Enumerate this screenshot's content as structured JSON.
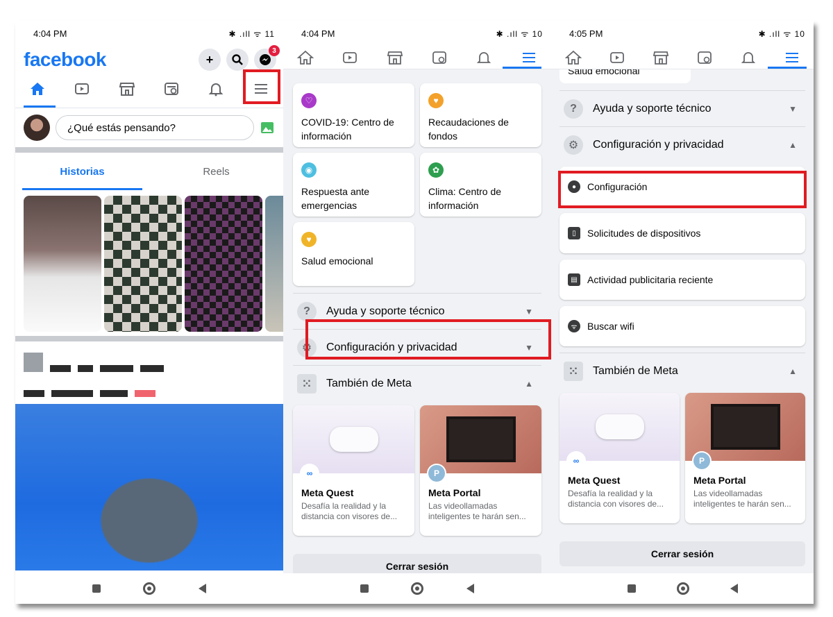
{
  "screen1": {
    "status": {
      "time": "4:04 PM",
      "icons": "✱ .ıll ᯤ 11"
    },
    "logo": "facebook",
    "messenger_badge": "3",
    "composer_placeholder": "¿Qué estás pensando?",
    "story_tabs": [
      "Historias",
      "Reels"
    ]
  },
  "screen2": {
    "status": {
      "time": "4:04 PM",
      "icons": "✱ .ıll ᯤ 10"
    },
    "shortcuts": [
      {
        "label": "COVID-19: Centro de información",
        "icon_color": "#a93ac9"
      },
      {
        "label": "Recaudaciones de fondos",
        "icon_color": "#f3a12b"
      },
      {
        "label": "Respuesta ante emergencias",
        "icon_color": "#4ebfe0"
      },
      {
        "label": "Clima: Centro de información",
        "icon_color": "#2e9e4f"
      },
      {
        "label": "Salud emocional",
        "icon_color": "#f0b429"
      }
    ],
    "sections": [
      "Ayuda y soporte técnico",
      "Configuración y privacidad",
      "También de Meta"
    ],
    "meta_cards": [
      {
        "title": "Meta Quest",
        "desc": "Desafía la realidad y la distancia con visores de..."
      },
      {
        "title": "Meta Portal",
        "desc": "Las videollamadas inteligentes te harán sen..."
      }
    ],
    "logout": "Cerrar sesión"
  },
  "screen3": {
    "status": {
      "time": "4:05 PM",
      "icons": "✱ .ıll ᯤ 10"
    },
    "top_partial": "Salud emocional",
    "sections": [
      "Ayuda y soporte técnico",
      "Configuración y privacidad"
    ],
    "settings_items": [
      "Configuración",
      "Solicitudes de dispositivos",
      "Actividad publicitaria reciente",
      "Buscar wifi"
    ],
    "meta_section": "También de Meta",
    "meta_cards": [
      {
        "title": "Meta Quest",
        "desc": "Desafía la realidad y la distancia con visores de..."
      },
      {
        "title": "Meta Portal",
        "desc": "Las videollamadas inteligentes te harán sen..."
      }
    ],
    "logout": "Cerrar sesión"
  },
  "colors": {
    "brand": "#1877f2",
    "highlight": "#e11b22"
  }
}
